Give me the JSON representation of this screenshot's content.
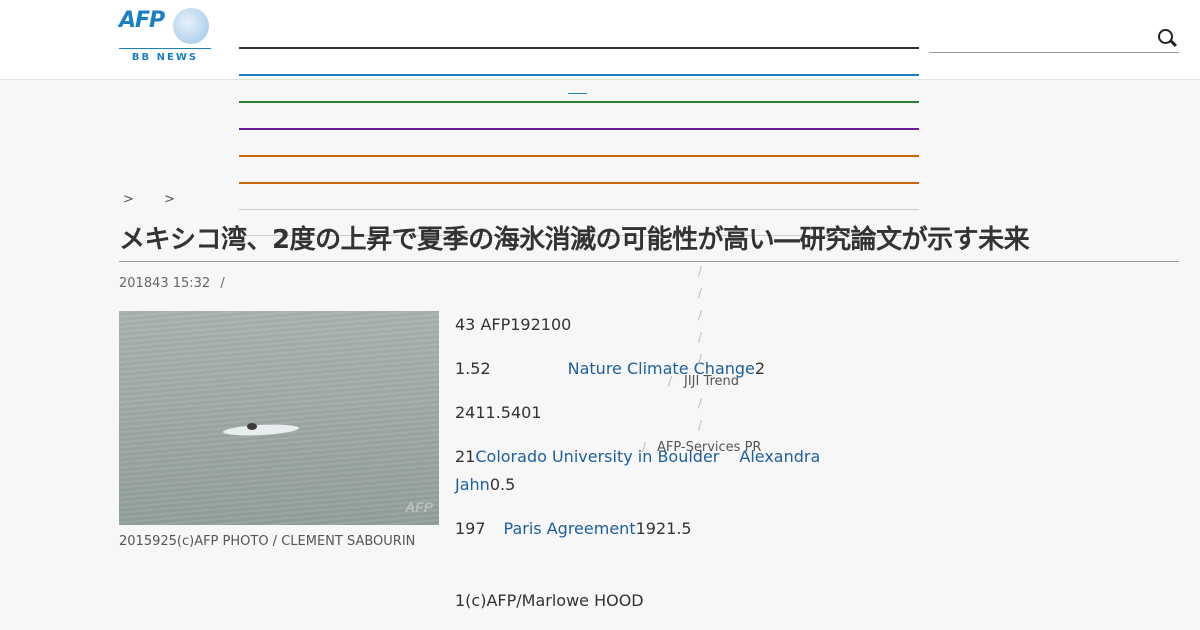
{
  "header": {
    "logo": {
      "text": "AFP",
      "subtitle": "BB NEWS"
    }
  },
  "breadcrumb": {
    "sep1": ">",
    "sep2": ">"
  },
  "article": {
    "title": "メキシコ湾、2度の上昇で夏季の海氷消滅の可能性が高い―研究論文が示す未来",
    "date": "201843 15:32",
    "date_sep": "/",
    "caption": "2015925(c)AFP PHOTO / CLEMENT SABOURIN",
    "paragraphs": {
      "p1": "43 AFP192100",
      "p2_a": "1.52",
      "p2_link": "Nature Climate Change",
      "p2_b": "2",
      "p3": "2411.5401",
      "p4_a": "21",
      "p4_link1": "Colorado University in Boulder",
      "p4_link2": "Alexandra",
      "p4_link2b": "Jahn",
      "p4_b": "0.5",
      "p5_a": "197",
      "p5_link": "Paris Agreement",
      "p5_b": "1921.5",
      "p6": "1(c)AFP/Marlowe HOOD"
    }
  },
  "sidebar": {
    "jiji": "JIJI Trend",
    "afp_services": "AFP-Services PR",
    "slash": "/"
  },
  "colors": {
    "brand": "#1c7fc0",
    "link": "#1e5f9b"
  }
}
